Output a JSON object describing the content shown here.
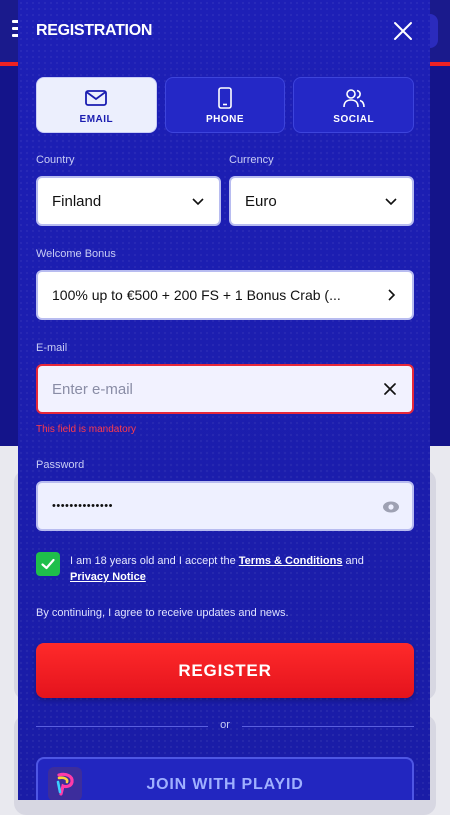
{
  "modal": {
    "title": "REGISTRATION",
    "tabs": [
      {
        "label": "EMAIL",
        "icon": "mail-icon",
        "active": true
      },
      {
        "label": "PHONE",
        "icon": "phone-icon",
        "active": false
      },
      {
        "label": "SOCIAL",
        "icon": "users-icon",
        "active": false
      }
    ]
  },
  "form": {
    "country": {
      "label": "Country",
      "value": "Finland"
    },
    "currency": {
      "label": "Currency",
      "value": "Euro"
    },
    "bonus": {
      "label": "Welcome Bonus",
      "value": "100% up to €500 + 200 FS + 1 Bonus Crab  (..."
    },
    "email": {
      "label": "E-mail",
      "placeholder": "Enter e-mail",
      "error": "This field is mandatory"
    },
    "password": {
      "label": "Password",
      "value": "••••••••••••••"
    },
    "consent": {
      "checked": true,
      "prefix": "I am 18 years old and I accept the ",
      "terms": "Terms & Conditions",
      "and": " and ",
      "privacy": "Privacy Notice"
    },
    "notice": "By continuing, I agree to receive updates and news.",
    "register_label": "REGISTER",
    "or_label": "or",
    "playid_label": "JOIN WITH PLAYID"
  },
  "colors": {
    "modal_bg": "#1a1db0",
    "accent_red": "#e4131d",
    "error": "#e6283a",
    "checkbox": "#1fbf4b"
  }
}
